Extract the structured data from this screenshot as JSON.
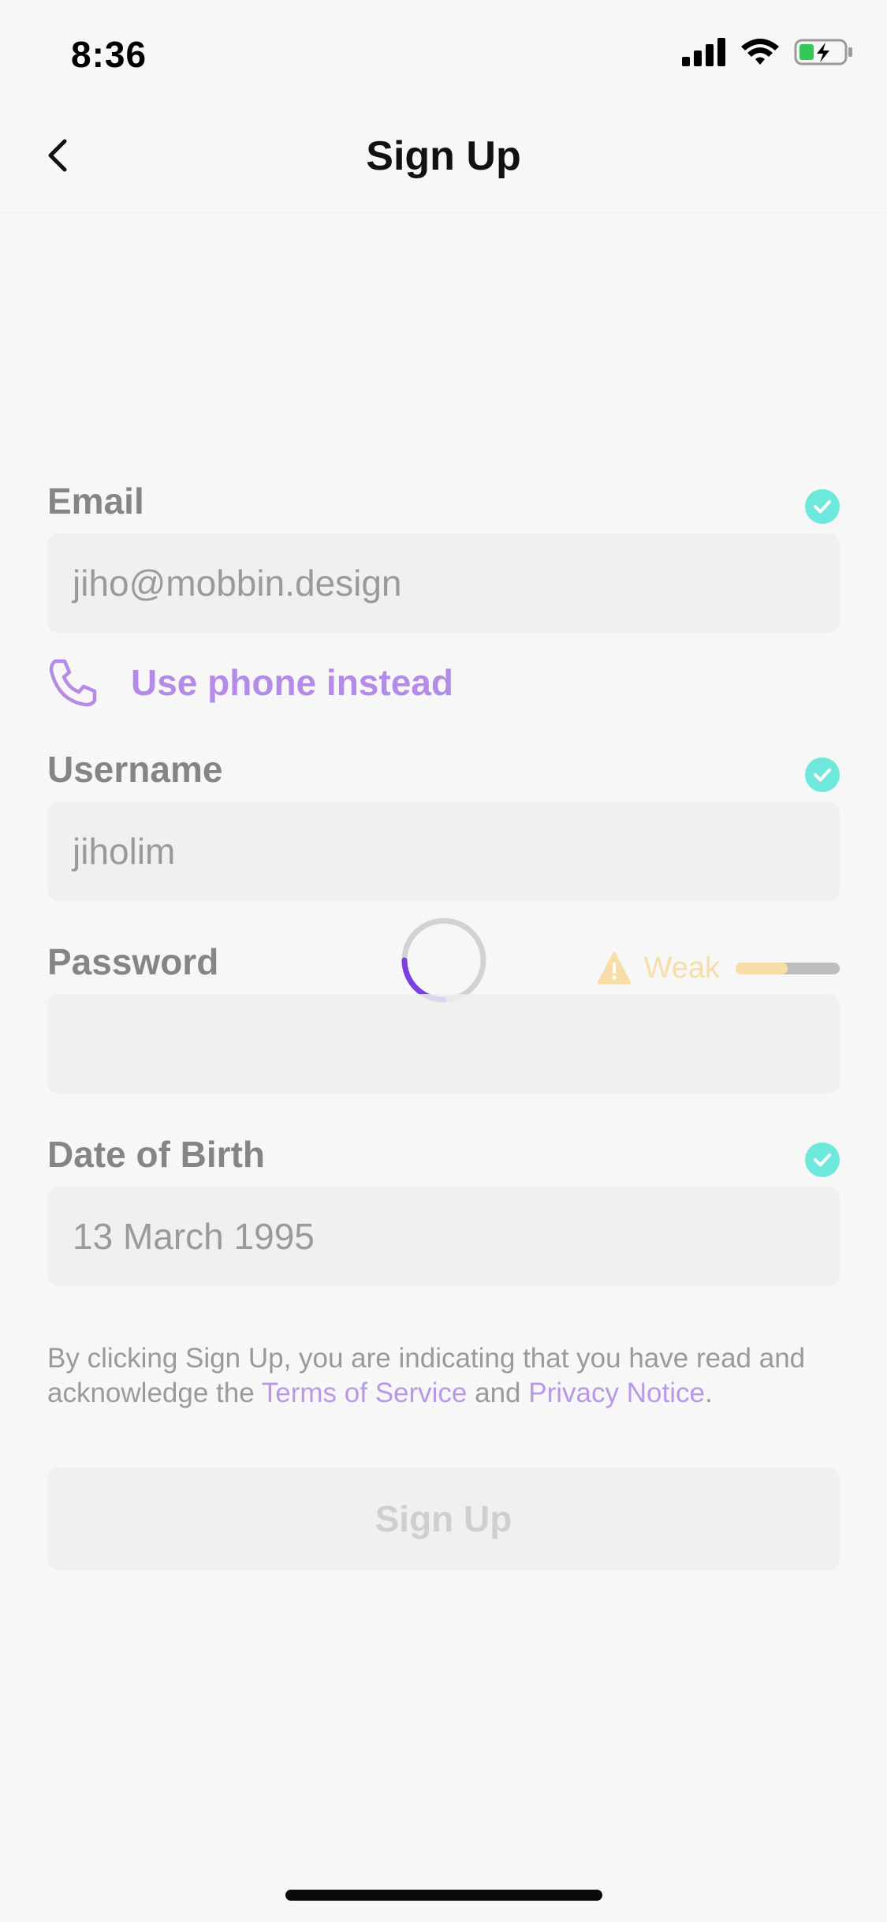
{
  "status_bar": {
    "time": "8:36",
    "icons": [
      "signal-icon",
      "wifi-icon",
      "battery-charging-icon"
    ],
    "battery_color": "#34c759"
  },
  "nav": {
    "back_icon": "chevron-left-icon",
    "title": "Sign Up"
  },
  "form": {
    "email": {
      "label": "Email",
      "value": "jiho@mobbin.design",
      "valid": true
    },
    "phone_link": {
      "icon": "phone-icon",
      "label": "Use phone instead"
    },
    "username": {
      "label": "Username",
      "value": "jiholim",
      "valid": true
    },
    "password": {
      "label": "Password",
      "value": "",
      "strength_label": "Weak",
      "strength_level": 0.5,
      "warning_icon": "warning-icon"
    },
    "date_of_birth": {
      "label": "Date of Birth",
      "value": "13 March 1995",
      "valid": true
    }
  },
  "loading_indicator": "spinner-icon",
  "terms": {
    "prefix": "By clicking Sign Up, you are indicating that you have read and acknowledge the ",
    "terms_link": "Terms of Service",
    "middle": " and ",
    "privacy_link": "Privacy Notice",
    "suffix": "."
  },
  "signup_button": {
    "label": "Sign Up",
    "enabled": false
  },
  "colors": {
    "accent": "#b48ce8",
    "spinner_accent": "#7b3fe4",
    "valid_check": "#6ee7dc",
    "weak": "#f7dea9"
  }
}
